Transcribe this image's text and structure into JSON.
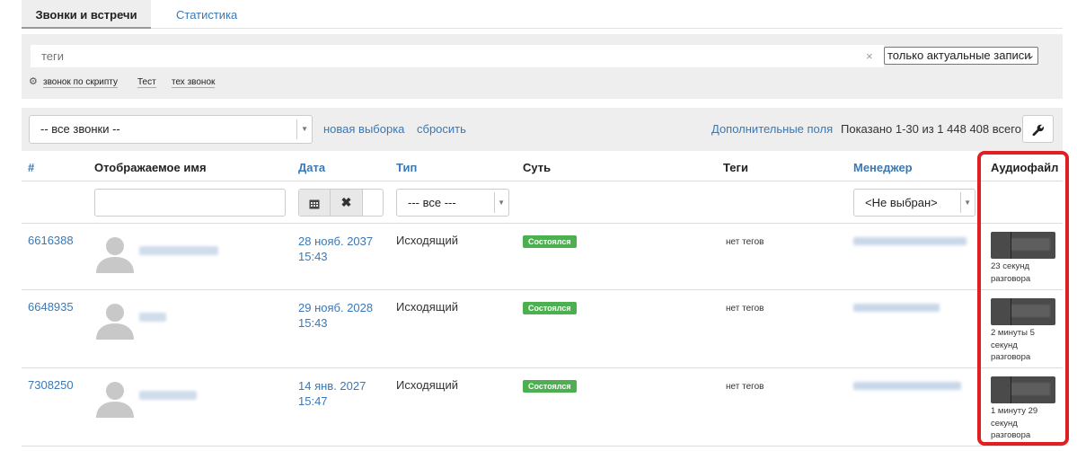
{
  "tabs": [
    {
      "label": "Звонки и встречи",
      "active": true
    },
    {
      "label": "Статистика",
      "active": false
    }
  ],
  "tags_panel": {
    "tags_placeholder": "теги",
    "clear_symbol": "×",
    "filter_select_value": "только актуальные записи",
    "quick_tags": [
      "звонок по скрипту",
      "Тест",
      "тех звонок"
    ]
  },
  "toolbar": {
    "calls_select_value": "-- все звонки --",
    "new_selection_link": "новая выборка",
    "reset_link": "сбросить",
    "extra_fields_link": "Дополнительные поля",
    "shown_text": "Показано 1-30 из 1 448 408 всего."
  },
  "table": {
    "headers": {
      "id": "#",
      "display_name": "Отображаемое имя",
      "date": "Дата",
      "type": "Тип",
      "essence": "Суть",
      "tags": "Теги",
      "manager": "Менеджер",
      "audio": "Аудиофайл"
    },
    "filters": {
      "type_select": "--- все ---",
      "manager_select": "<Не выбран>"
    },
    "rows": [
      {
        "id": "6616388",
        "date": "28 нояб. 2037",
        "time": "15:43",
        "type": "Исходящий",
        "status": "Состоялся",
        "tags": "нет тегов",
        "duration_line1": "23 секунд",
        "duration_line2": "разговора",
        "duration_line3": ""
      },
      {
        "id": "6648935",
        "date": "29 нояб. 2028",
        "time": "15:43",
        "type": "Исходящий",
        "status": "Состоялся",
        "tags": "нет тегов",
        "duration_line1": "2 минуты 5",
        "duration_line2": "секунд",
        "duration_line3": "разговора"
      },
      {
        "id": "7308250",
        "date": "14 янв. 2027",
        "time": "15:47",
        "type": "Исходящий",
        "status": "Состоялся",
        "tags": "нет тегов",
        "duration_line1": "1 минуту 29",
        "duration_line2": "секунд",
        "duration_line3": "разговора"
      }
    ]
  },
  "colors": {
    "link": "#3a78b5",
    "status_badge": "#4caf50",
    "highlight": "#e02020"
  }
}
